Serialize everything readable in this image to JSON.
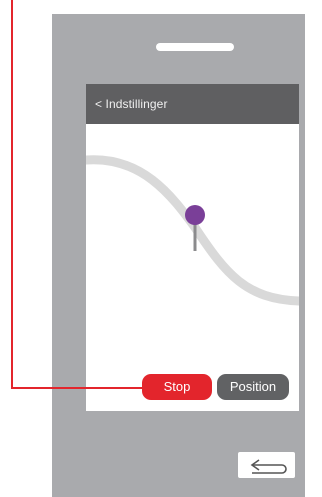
{
  "screen": {
    "header": {
      "back_label": "< Indstillinger"
    },
    "buttons": {
      "stop_label": "Stop",
      "position_label": "Position"
    }
  },
  "colors": {
    "phone_body": "#a9aaad",
    "header_bg": "#5f5f61",
    "stop_button": "#e3252c",
    "position_button": "#616264",
    "pin": "#7a3f98",
    "route": "#d9d9d9",
    "callout_line": "#e3252c"
  },
  "icons": {
    "map_pin": "map-pin-icon",
    "return": "return-arrow-icon"
  }
}
